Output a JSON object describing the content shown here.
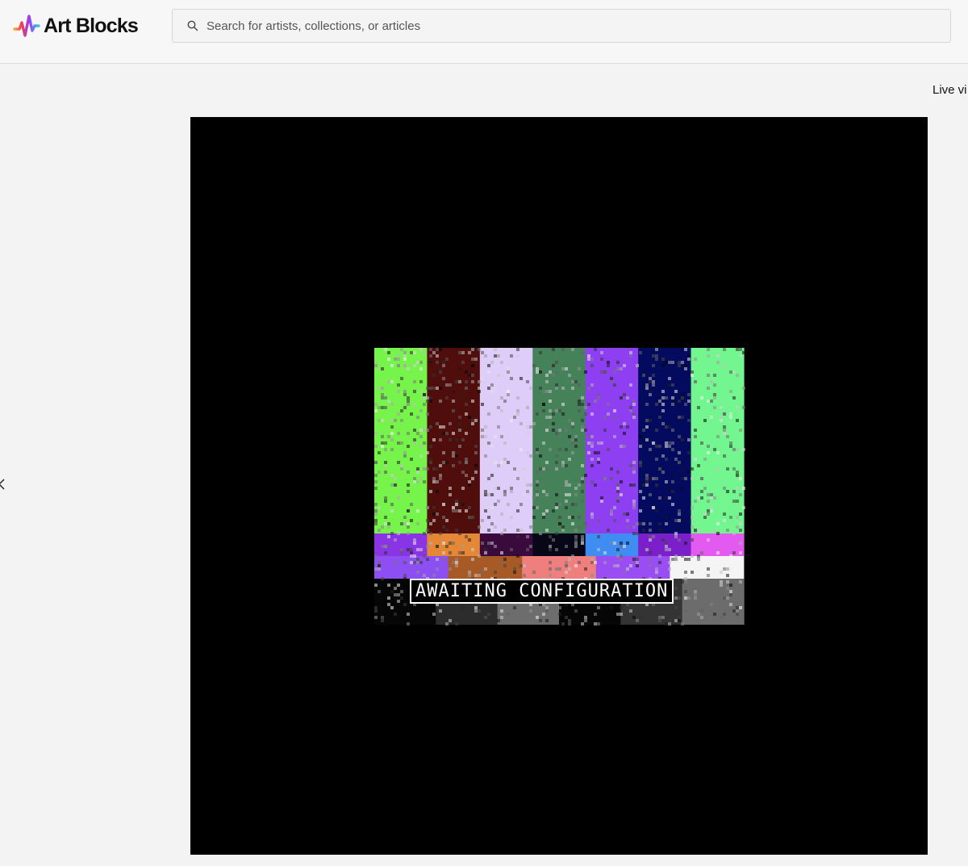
{
  "app": {
    "brand_name": "Art Blocks",
    "logo_icon": "art-blocks-wave-logo"
  },
  "search": {
    "placeholder": "Search for artists, collections, or articles",
    "value": "",
    "icon": "search-icon"
  },
  "viewer": {
    "live_view_label": "Live vi",
    "prev_icon": "chevron-left-icon"
  },
  "artwork": {
    "overlay_text": "AWAITING CONFIGURATION",
    "background_color": "#000000",
    "color_bars_top": [
      "#76f44c",
      "#4f0d0b",
      "#dfcdf9",
      "#468259",
      "#8d3ff1",
      "#040b5e",
      "#73f58f"
    ],
    "color_bars_mid": [
      "#8a34e6",
      "#e48737",
      "#3a0a3c",
      "#070718",
      "#3f8df2",
      "#7a1fc9",
      "#e35af1"
    ],
    "color_bars_low": [
      "#8d4ff2",
      "#a85a26",
      "#ef7f7d",
      "#9a4df3",
      "#f4f4f4"
    ],
    "color_bars_bottom": [
      "#060606",
      "#2c2c2c",
      "#6d6d6d",
      "#060606",
      "#343434",
      "#6c6c6c"
    ]
  }
}
